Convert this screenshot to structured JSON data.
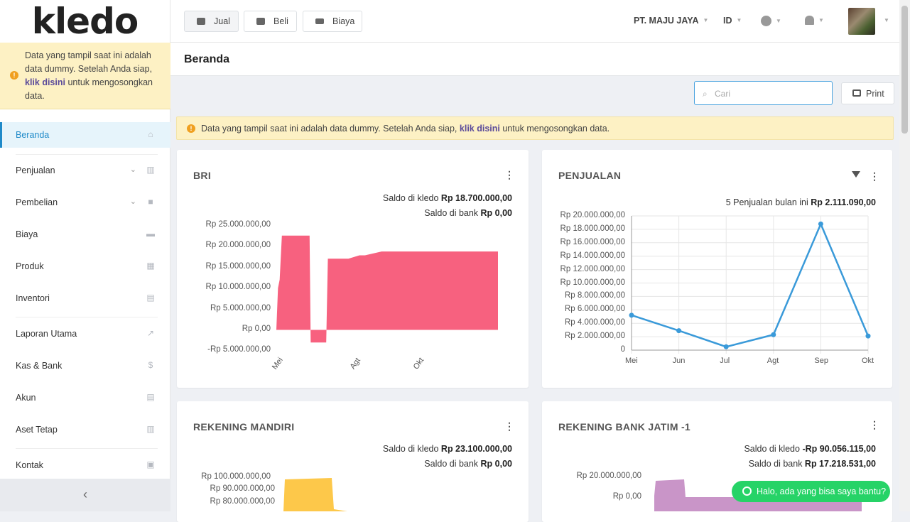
{
  "brand": {
    "logo": "kledo"
  },
  "sidebar": {
    "notice": {
      "text1": "Data yang tampil saat ini adalah data dummy. Setelah Anda siap, ",
      "link": "klik disini",
      "text2": " untuk mengosongkan data."
    },
    "items": [
      {
        "label": "Beranda",
        "icon": "home-icon"
      },
      {
        "label": "Penjualan",
        "icon": "basket-icon"
      },
      {
        "label": "Pembelian",
        "icon": "bag-icon"
      },
      {
        "label": "Biaya",
        "icon": "card-icon"
      },
      {
        "label": "Produk",
        "icon": "boxes-icon"
      },
      {
        "label": "Inventori",
        "icon": "warehouse-icon"
      },
      {
        "label": "Laporan Utama",
        "icon": "chart-line-icon"
      },
      {
        "label": "Kas & Bank",
        "icon": "dollar-icon"
      },
      {
        "label": "Akun",
        "icon": "list-icon"
      },
      {
        "label": "Aset Tetap",
        "icon": "building-icon"
      },
      {
        "label": "Kontak",
        "icon": "contact-card-icon"
      }
    ],
    "collapse": "‹"
  },
  "topbar": {
    "buttons": [
      {
        "label": "Jual",
        "icon": "basket-icon"
      },
      {
        "label": "Beli",
        "icon": "bag-icon"
      },
      {
        "label": "Biaya",
        "icon": "card-icon"
      }
    ],
    "company": "PT. MAJU JAYA",
    "lang": "ID"
  },
  "page": {
    "title": "Beranda",
    "search_placeholder": "Cari",
    "print": "Print"
  },
  "main_notice": {
    "text1": "Data yang tampil saat ini adalah data dummy. Setelah Anda siap, ",
    "link": "klik disini",
    "text2": " untuk mengosongkan data."
  },
  "cards": {
    "bri": {
      "title": "BRI",
      "saldo_kledo_label": "Saldo di kledo ",
      "saldo_kledo": "Rp 18.700.000,00",
      "saldo_bank_label": "Saldo di bank ",
      "saldo_bank": "Rp 0,00"
    },
    "penjualan": {
      "title": "PENJUALAN",
      "summary_label": "5 Penjualan bulan ini ",
      "summary": "Rp 2.111.090,00"
    },
    "mandiri": {
      "title": "REKENING MANDIRI",
      "saldo_kledo_label": "Saldo di kledo ",
      "saldo_kledo": "Rp 23.100.000,00",
      "saldo_bank_label": "Saldo di bank ",
      "saldo_bank": "Rp 0,00"
    },
    "jatim": {
      "title": "REKENING BANK JATIM -1",
      "saldo_kledo_label": "Saldo di kledo ",
      "saldo_kledo": "-Rp 90.056.115,00",
      "saldo_bank_label": "Saldo di bank ",
      "saldo_bank": "Rp 17.218.531,00"
    }
  },
  "whatsapp": {
    "label": "Halo, ada yang bisa saya bantu?"
  },
  "chart_data": [
    {
      "type": "area",
      "title": "BRI",
      "color": "#f7617f",
      "y_ticks": [
        "Rp 25.000.000,00",
        "Rp 20.000.000,00",
        "Rp 15.000.000,00",
        "Rp 10.000.000,00",
        "Rp 5.000.000,00",
        "Rp 0,00",
        "-Rp 5.000.000,00"
      ],
      "x_ticks": [
        "Mei",
        "Agt",
        "Okt"
      ],
      "ylim": [
        -5000000,
        25000000
      ],
      "x": [
        0,
        0.3,
        0.6,
        1,
        3,
        4,
        6,
        6.2,
        9,
        9.3,
        12,
        13,
        15,
        16,
        19,
        20,
        40
      ],
      "values": [
        0,
        10000000,
        12000000,
        22500000,
        22500000,
        22500000,
        22500000,
        -3000000,
        -3000000,
        17000000,
        17000000,
        17000000,
        17800000,
        17800000,
        18700000,
        18700000,
        18700000
      ]
    },
    {
      "type": "line",
      "title": "PENJUALAN",
      "color": "#3a9ad9",
      "categories": [
        "Mei",
        "Jun",
        "Jul",
        "Agt",
        "Sep",
        "Okt"
      ],
      "values": [
        5200000,
        2900000,
        500000,
        2300000,
        18800000,
        2100000
      ],
      "y_ticks": [
        "Rp 20.000.000,00",
        "Rp 18.000.000,00",
        "Rp 16.000.000,00",
        "Rp 14.000.000,00",
        "Rp 12.000.000,00",
        "Rp 10.000.000,00",
        "Rp 8.000.000,00",
        "Rp 6.000.000,00",
        "Rp 4.000.000,00",
        "Rp 2.000.000,00",
        "0"
      ],
      "ylim": [
        0,
        20000000
      ],
      "grid": true
    },
    {
      "type": "area",
      "title": "REKENING MANDIRI",
      "color": "#fdc84a",
      "y_ticks": [
        "Rp 100.000.000,00",
        "Rp 90.000.000,00",
        "Rp 80.000.000,00"
      ]
    },
    {
      "type": "area",
      "title": "REKENING BANK JATIM -1",
      "color": "#c995c8",
      "y_ticks": [
        "Rp 20.000.000,00",
        "Rp 0,00"
      ]
    }
  ]
}
